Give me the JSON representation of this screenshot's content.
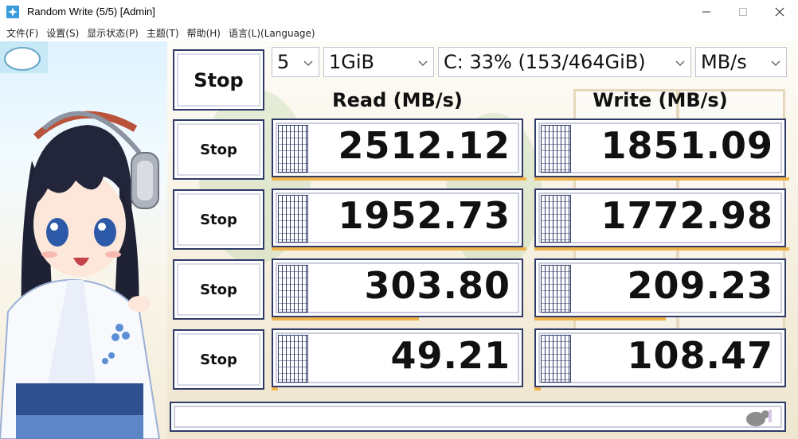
{
  "window": {
    "title": "Random Write (5/5) [Admin]",
    "icon": "crystaldiskmark-icon"
  },
  "menu": {
    "items": [
      "文件(F)",
      "设置(S)",
      "显示状态(P)",
      "主题(T)",
      "帮助(H)",
      "语言(L)(Language)"
    ]
  },
  "controls": {
    "all_button": "Stop",
    "count": "5",
    "size": "1GiB",
    "drive": "C: 33% (153/464GiB)",
    "unit": "MB/s"
  },
  "headers": {
    "read": "Read (MB/s)",
    "write": "Write (MB/s)"
  },
  "rows": [
    {
      "button": "Stop",
      "read": "2512.12",
      "write": "1851.09"
    },
    {
      "button": "Stop",
      "read": "1952.73",
      "write": "1772.98"
    },
    {
      "button": "Stop",
      "read": "303.80",
      "write": "209.23"
    },
    {
      "button": "Stop",
      "read": "49.21",
      "write": "108.47"
    }
  ],
  "status_text": "",
  "colors": {
    "frame": "#2f3b68",
    "accent_bar": "#f0b24a",
    "background": "#fbf6ec"
  }
}
